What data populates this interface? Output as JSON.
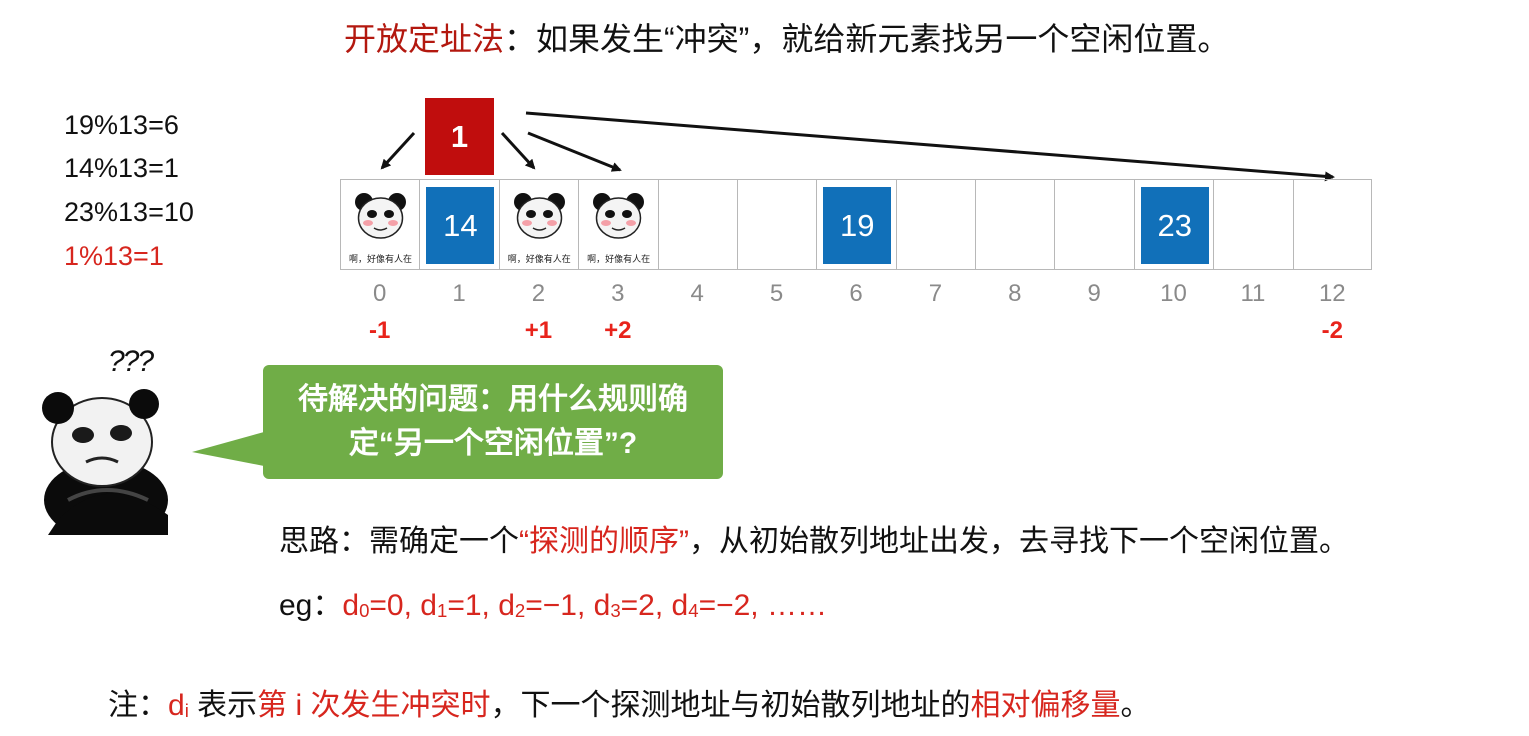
{
  "title": {
    "highlight": "开放定址法",
    "rest": "：如果发生“冲突”，就给新元素找另一个空闲位置。"
  },
  "hash_lines": [
    "19%13=6",
    "14%13=1",
    "23%13=10",
    "1%13=1"
  ],
  "colors": {
    "blue_box": "#1170b9",
    "new_box": "#c00d0d",
    "bubble": "#70ad47",
    "highlight_red": "#d7261e",
    "index_gray": "#8a8a8a"
  },
  "table": {
    "indices": [
      "0",
      "1",
      "2",
      "3",
      "4",
      "5",
      "6",
      "7",
      "8",
      "9",
      "10",
      "11",
      "12"
    ],
    "values": [
      "",
      "14",
      "",
      "",
      "",
      "",
      "19",
      "",
      "",
      "",
      "23",
      "",
      ""
    ],
    "panda_caption": "啊，好像有人在",
    "panda_cells": [
      0,
      2,
      3
    ]
  },
  "new_element": "1",
  "offsets": [
    {
      "label": "-1",
      "index": 0
    },
    {
      "label": "+1",
      "index": 2
    },
    {
      "label": "+2",
      "index": 3
    },
    {
      "label": "-2",
      "index": 12
    }
  ],
  "panda_marks": "???",
  "bubble": {
    "line1": "待解决的问题：用什么规则确",
    "line2": "定“另一个空闲位置”?"
  },
  "idea": {
    "prefix": "思路：需确定一个",
    "highlight": "“探测的顺序”",
    "suffix": "，从初始散列地址出发，去寻找下一个空闲位置。"
  },
  "eg": {
    "prefix": "eg：",
    "items": [
      {
        "d": "d",
        "sub": "0",
        "val": "=0, "
      },
      {
        "d": "d",
        "sub": "1",
        "val": "=1, "
      },
      {
        "d": "d",
        "sub": "2",
        "val": "=−1, "
      },
      {
        "d": "d",
        "sub": "3",
        "val": "=2, "
      },
      {
        "d": "d",
        "sub": "4",
        "val": "=−2, ……"
      }
    ]
  },
  "note": {
    "p1": "注：",
    "d": "d",
    "sub": "i",
    "p2": " 表示",
    "h1": "第 i 次发生冲突时",
    "p3": "，下一个探测地址与初始散列地址的",
    "h2": "相对偏移量",
    "p4": "。"
  }
}
